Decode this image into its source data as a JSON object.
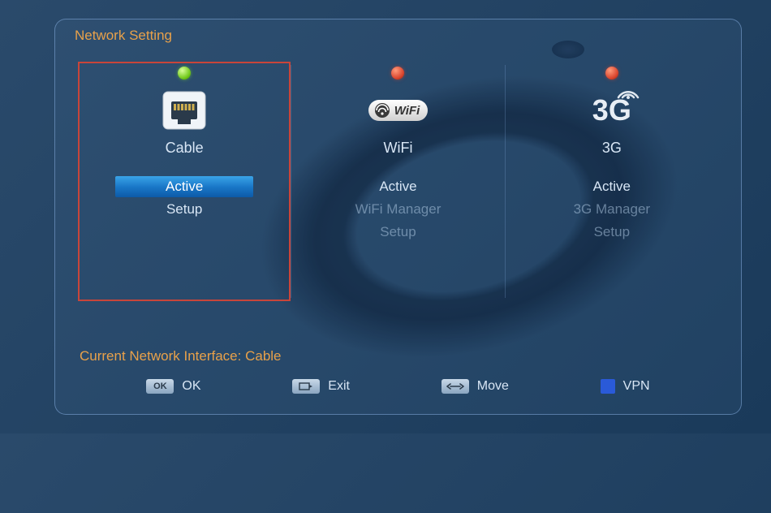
{
  "panel": {
    "title": "Network Setting",
    "status_prefix": "Current Network Interface:",
    "current_interface": "Cable"
  },
  "columns": [
    {
      "id": "cable",
      "label": "Cable",
      "status": "green",
      "selected": true,
      "icon": "ethernet",
      "items": [
        {
          "label": "Active",
          "highlight": true,
          "dim": false
        },
        {
          "label": "Setup",
          "highlight": false,
          "dim": false
        }
      ]
    },
    {
      "id": "wifi",
      "label": "WiFi",
      "status": "red",
      "selected": false,
      "icon": "wifi",
      "items": [
        {
          "label": "Active",
          "highlight": false,
          "dim": false
        },
        {
          "label": "WiFi Manager",
          "highlight": false,
          "dim": true
        },
        {
          "label": "Setup",
          "highlight": false,
          "dim": true
        }
      ]
    },
    {
      "id": "3g",
      "label": "3G",
      "status": "red",
      "selected": false,
      "icon": "3g",
      "items": [
        {
          "label": "Active",
          "highlight": false,
          "dim": false
        },
        {
          "label": "3G Manager",
          "highlight": false,
          "dim": true
        },
        {
          "label": "Setup",
          "highlight": false,
          "dim": true
        }
      ]
    }
  ],
  "legend": {
    "ok": {
      "key": "OK",
      "label": "OK"
    },
    "exit": {
      "key": "exit-icon",
      "label": "Exit"
    },
    "move": {
      "key": "arrows-icon",
      "label": "Move"
    },
    "vpn": {
      "label": "VPN",
      "color": "#2a5ad8"
    }
  },
  "icons": {
    "wifi_badge_text": "WiFi",
    "g3_text": "3G"
  }
}
